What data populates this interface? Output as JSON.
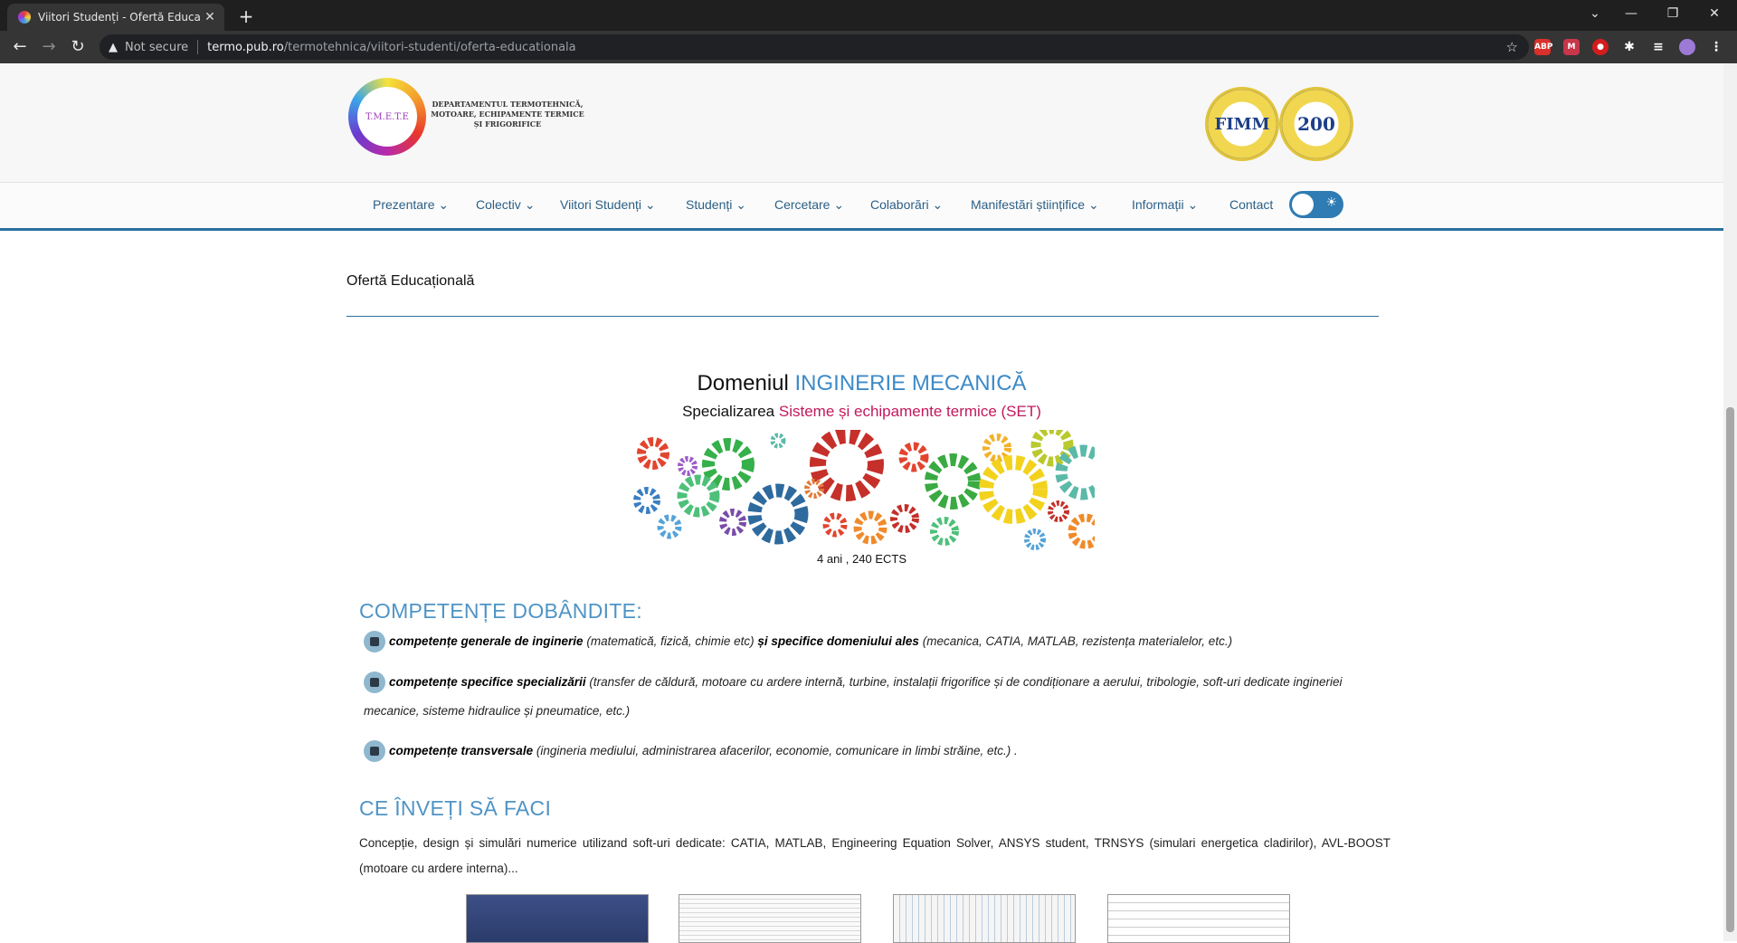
{
  "browser": {
    "tab_title": "Viitori Studenți - Ofertă Educațio",
    "tab_close": "✕",
    "new_tab": "+",
    "not_secure": "Not secure",
    "url_host": "termo.pub.ro",
    "url_path": "/termotehnica/viitori-studenti/oferta-educationala",
    "extensions": [
      "ABP",
      "M",
      "●",
      "✱",
      "≡"
    ]
  },
  "header": {
    "logo_text": "T.M.E.T.E",
    "dept_name": "DEPARTAMENTUL TERMOTEHNICĂ, MOTOARE, ECHIPAMENTE TERMICE ȘI FRIGORIFICE",
    "seal1_text": "FIMM",
    "seal2_text": "200"
  },
  "nav": {
    "items": [
      "Prezentare",
      "Colectiv",
      "Viitori Studenți",
      "Studenți",
      "Cercetare",
      "Colaborări",
      "Manifestări științifice",
      "Informații"
    ],
    "contact": "Contact"
  },
  "page": {
    "title": "Ofertă Educațională",
    "domeniu_prefix": "Domeniul ",
    "domeniu_name": "INGINERIE MECANICĂ",
    "spec_prefix": "Specializarea ",
    "spec_name": "Sisteme și echipamente termice (SET)",
    "ects": "4 ani , 240 ECTS"
  },
  "competente": {
    "heading": "COMPETENȚE DOBÂNDITE:",
    "items": [
      {
        "bold": "competențe generale de inginerie",
        "rest1": " (matematică, fizică, chimie etc) ",
        "bold2": "și specifice domeniului ales",
        "rest2": " (mecanica, CATIA, MATLAB, rezistența materialelor, etc.)"
      },
      {
        "bold": "competențe specifice specializării",
        "rest1": " (transfer de căldură, motoare cu ardere internă, turbine, instalații frigorifice și de condiționare a aerului, tribologie, soft-uri dedicate ingineriei mecanice, sisteme hidraulice și pneumatice, etc.)"
      },
      {
        "bold": "competențe transversale",
        "rest1": " (ingineria mediului, administrarea afacerilor, economie, comunicare in limbi străine, etc.) ."
      }
    ]
  },
  "invata": {
    "heading": "CE ÎNVEȚI SĂ FACI",
    "text": "Concepție, design și simulări numerice utilizand soft-uri dedicate: CATIA, MATLAB, Engineering Equation Solver, ANSYS student, TRNSYS (simulari energetica cladirilor), AVL-BOOST (motoare cu ardere interna)..."
  },
  "colors": {
    "accent": "#2b6f9e",
    "heading": "#4f94c5",
    "domain_highlight": "#3d8ac7",
    "spec_highlight": "#c2185b"
  }
}
